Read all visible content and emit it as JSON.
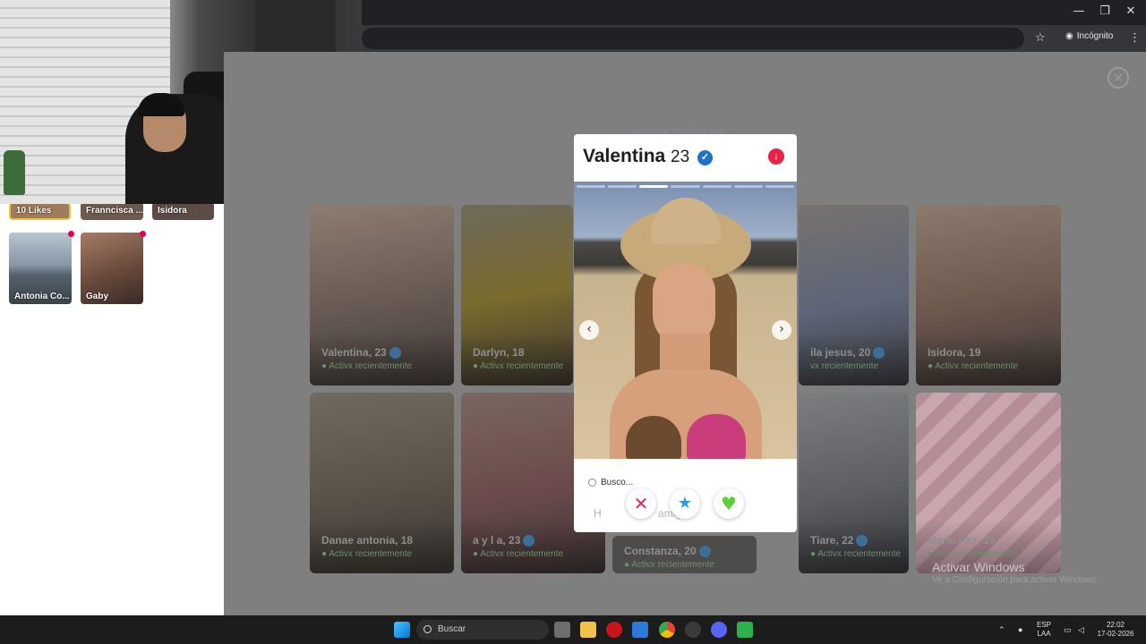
{
  "browser": {
    "incognito_label": "Incógnito",
    "window_controls": [
      "—",
      "❐",
      "✕"
    ]
  },
  "sidebar": {
    "tiles": [
      {
        "label": "10 Likes"
      },
      {
        "label": "Franncisca ..."
      },
      {
        "label": "Isidora"
      }
    ],
    "matches": [
      {
        "label": "Antonia Co..."
      },
      {
        "label": "Gaby"
      }
    ]
  },
  "background": {
    "top_link": "Ver hasta 100 likes más",
    "cards": [
      {
        "name": "Valentina, 23",
        "status": "● Activx recientemente"
      },
      {
        "name": "Darlyn, 18",
        "status": "● Activx recientemente"
      },
      {
        "name": "ila jesus, 20",
        "status": "vx recientemente"
      },
      {
        "name": "Isidora, 19",
        "status": "● Activx recientemente"
      },
      {
        "name": "Danae antonia, 18",
        "status": "● Activx recientemente"
      },
      {
        "name": "a y l a, 23",
        "status": "● Activx recientemente"
      },
      {
        "name": "Constanza, 20",
        "status": "● Activx recientemente"
      },
      {
        "name": "Tiare, 22",
        "status": "● Activx recientemente"
      },
      {
        "name": "Maria Paz, 19",
        "status": "● Activx recientemente"
      }
    ]
  },
  "profile": {
    "name": "Valentina",
    "age": "23",
    "photo_count": 7,
    "active_photo": 3,
    "search_label": "Busco...",
    "ghost_text": "H",
    "ghost_text_2": "amig",
    "actions": {
      "nope": "✕",
      "super_like": "★",
      "like": "♥"
    },
    "colors": {
      "nope": "#e5245b",
      "super_like": "#2d9ae6",
      "like": "#5fcf3a"
    }
  },
  "windows": {
    "activate_title": "Activar Windows",
    "activate_sub": "Ve a Configuración para activar Windows.",
    "search_placeholder": "Buscar",
    "lang_1": "ESP",
    "lang_2": "LAA",
    "time": "22:02",
    "date": "17-02-2026"
  }
}
